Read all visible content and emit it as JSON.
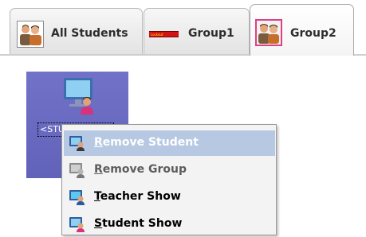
{
  "tabs": [
    {
      "label": "All Students",
      "icon": "students-group-icon",
      "active": false
    },
    {
      "label": "Group1",
      "icon": "lockout-banner-icon",
      "badge_text": "Lockout",
      "active": false
    },
    {
      "label": "Group2",
      "icon": "students-group-icon",
      "active": true
    }
  ],
  "student_tile": {
    "name": "<STUDEN",
    "icon": "student-computer-icon"
  },
  "context_menu": {
    "items": [
      {
        "first": "R",
        "rest": "emove Student",
        "icon": "remove-student-icon",
        "state": "highlighted"
      },
      {
        "first": "R",
        "rest": "emove Group",
        "icon": "remove-group-icon",
        "state": "disabled"
      },
      {
        "first": "T",
        "rest": "eacher Show",
        "icon": "teacher-show-icon",
        "state": "normal"
      },
      {
        "first": "S",
        "rest": "tudent Show",
        "icon": "student-show-icon",
        "state": "normal"
      }
    ]
  },
  "colors": {
    "tile_background": "#6f70c4",
    "menu_highlight": "#b7c8e3",
    "active_tab_icon_border": "#e04080",
    "lockout_red": "#d21313"
  }
}
